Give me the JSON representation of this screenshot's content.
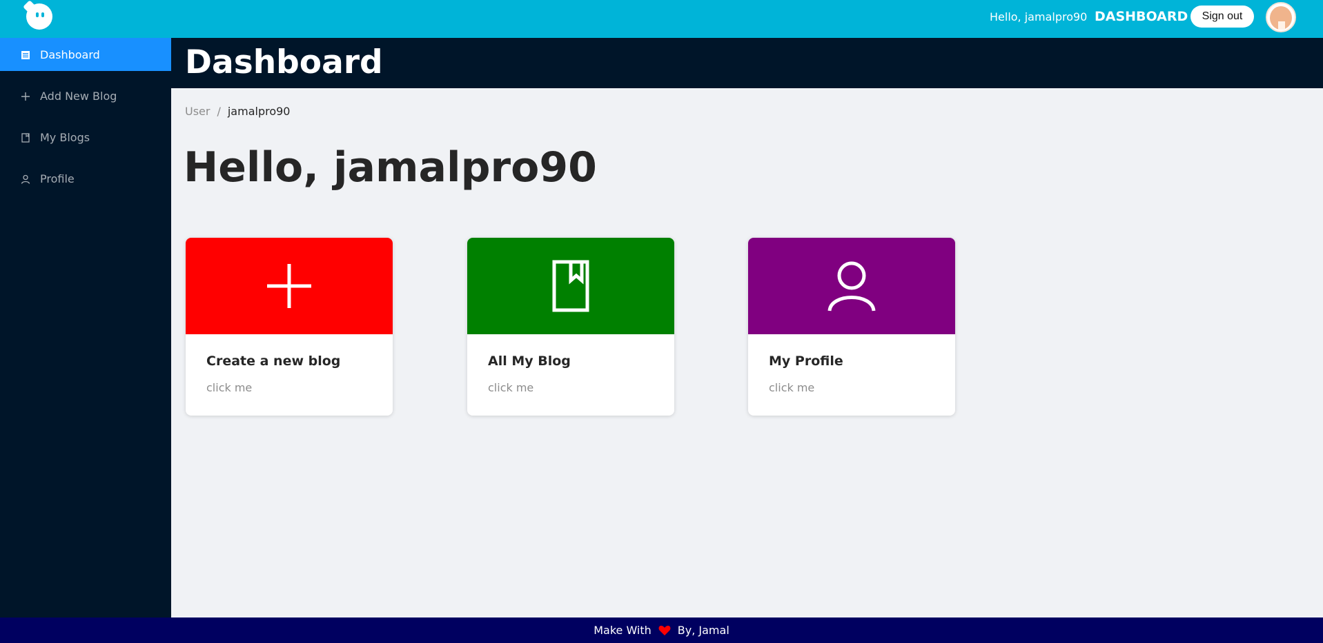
{
  "header": {
    "greeting": "Hello, jamalpro90",
    "dashboard_link": "DASHBOARD",
    "signout_label": "Sign out",
    "brand_color": "#00b4d8"
  },
  "sidebar": {
    "items": [
      {
        "label": "Dashboard",
        "icon": "dashboard-icon",
        "active": true
      },
      {
        "label": "Add New Blog",
        "icon": "plus-icon",
        "active": false
      },
      {
        "label": "My Blogs",
        "icon": "book-icon",
        "active": false
      },
      {
        "label": "Profile",
        "icon": "user-icon",
        "active": false
      }
    ]
  },
  "page": {
    "title": "Dashboard",
    "breadcrumb": [
      "User",
      "jamalpro90"
    ],
    "breadcrumb_separator": "/",
    "greeting": "Hello, jamalpro90"
  },
  "cards": [
    {
      "title": "Create a new blog",
      "description": "click me",
      "icon": "plus-icon",
      "color": "#ff0000"
    },
    {
      "title": "All My Blog",
      "description": "click me",
      "icon": "book-icon",
      "color": "#008000"
    },
    {
      "title": "My Profile",
      "description": "click me",
      "icon": "user-icon",
      "color": "#800080"
    }
  ],
  "footer": {
    "prefix": "Make With",
    "suffix": "By, Jamal",
    "icon": "heart-icon"
  }
}
